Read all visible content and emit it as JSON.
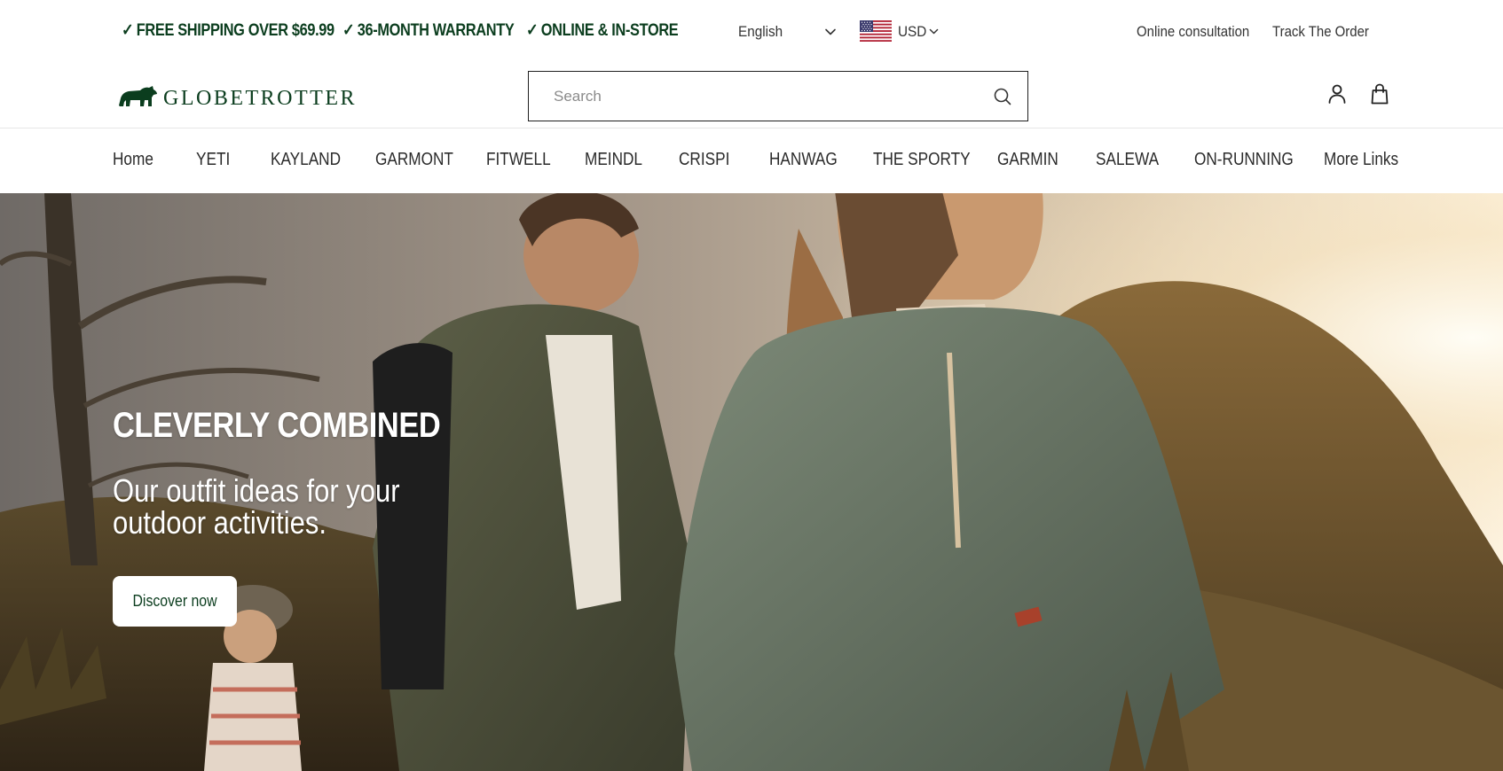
{
  "colors": {
    "brand_green": "#0b3d1e",
    "text_dark": "#2b2b2b",
    "background": "#ffffff"
  },
  "topbar": {
    "promos": [
      {
        "check": "✓",
        "label": "FREE SHIPPING OVER $69.99"
      },
      {
        "check": "✓",
        "label": "36-MONTH WARRANTY"
      },
      {
        "check": "✓",
        "label": "ONLINE & IN-STORE"
      }
    ],
    "language": {
      "selected": "English",
      "icon": "chevron-down-icon"
    },
    "currency": {
      "selected": "USD",
      "flag_icon": "us-flag-icon",
      "icon": "chevron-down-icon"
    },
    "links": [
      "Online consultation",
      "Track The Order"
    ]
  },
  "header": {
    "logo": {
      "text": "GLOBETROTTER",
      "icon": "bear-icon"
    },
    "search": {
      "placeholder": "Search",
      "value": "",
      "icon": "search-icon"
    },
    "icons": {
      "account": "user-icon",
      "cart": "shopping-bag-icon"
    }
  },
  "nav": {
    "items": [
      "Home",
      "YETI",
      "KAYLAND",
      "GARMONT",
      "FITWELL",
      "MEINDL",
      "CRISPI",
      "HANWAG",
      "THE SPORTY",
      "GARMIN",
      "SALEWA",
      "ON-RUNNING",
      "More Links"
    ]
  },
  "hero": {
    "title": "CLEVERLY COMBINED",
    "subtitle": "Our outfit ideas for your outdoor activities.",
    "cta": "Discover now"
  }
}
